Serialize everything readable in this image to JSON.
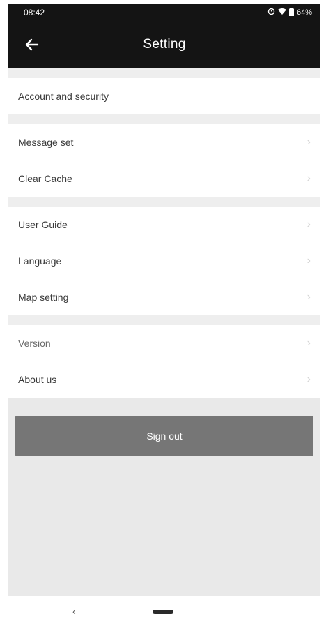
{
  "status_bar": {
    "time": "08:42",
    "battery": "64%",
    "icons": [
      "alarm-icon",
      "wifi-icon",
      "battery-icon"
    ]
  },
  "app_bar": {
    "title": "Setting",
    "back_icon": "arrow-left-icon"
  },
  "sections": [
    {
      "items": [
        {
          "label": "Account and security"
        }
      ]
    },
    {
      "items": [
        {
          "label": "Message set"
        },
        {
          "label": "Clear Cache"
        }
      ]
    },
    {
      "items": [
        {
          "label": "User Guide"
        },
        {
          "label": "Language"
        },
        {
          "label": "Map setting"
        }
      ]
    },
    {
      "items": [
        {
          "label": "Version"
        },
        {
          "label": "About us"
        }
      ]
    }
  ],
  "sign_out": {
    "label": "Sign out"
  },
  "nav_bar": {
    "back_glyph": "‹"
  },
  "colors": {
    "header_bg": "#141414",
    "page_bg": "#e9e9e9",
    "button_bg": "#767676"
  }
}
